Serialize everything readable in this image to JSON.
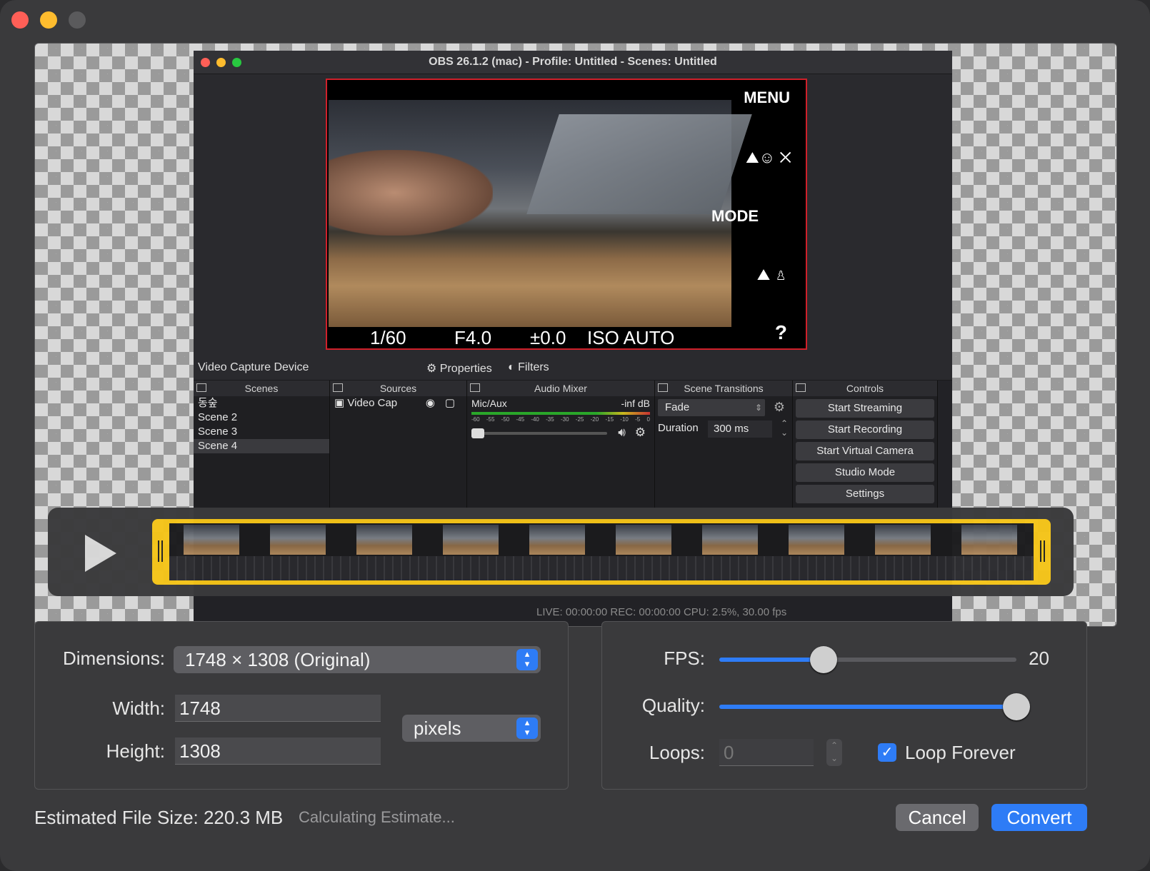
{
  "obs": {
    "title": "OBS 26.1.2 (mac) - Profile: Untitled - Scenes: Untitled",
    "camera": {
      "menu": "MENU",
      "mode": "MODE",
      "help": "?",
      "shutter": "1/60",
      "aperture": "F4.0",
      "exposure": "±0.0",
      "iso": "ISO AUTO"
    },
    "toolbar": {
      "source_name": "Video Capture Device",
      "properties": "Properties",
      "filters": "Filters"
    },
    "docks": {
      "scenes": {
        "title": "Scenes",
        "items": [
          "동숲",
          "Scene 2",
          "Scene 3",
          "Scene 4"
        ]
      },
      "sources": {
        "title": "Sources",
        "item": "Video Cap"
      },
      "mixer": {
        "title": "Audio Mixer",
        "channel": "Mic/Aux",
        "level": "-inf dB",
        "scale": [
          "-60",
          "-55",
          "-50",
          "-45",
          "-40",
          "-35",
          "-30",
          "-25",
          "-20",
          "-15",
          "-10",
          "-5",
          "0"
        ]
      },
      "transitions": {
        "title": "Scene Transitions",
        "type": "Fade",
        "duration_label": "Duration",
        "duration_value": "300 ms"
      },
      "controls": {
        "title": "Controls",
        "buttons": [
          "Start Streaming",
          "Start Recording",
          "Start Virtual Camera",
          "Studio Mode",
          "Settings"
        ]
      }
    },
    "status": "LIVE: 00:00:00     REC: 00:00:00     CPU: 2.5%, 30.00 fps"
  },
  "settings": {
    "dimensions_label": "Dimensions:",
    "dimensions_value": "1748 × 1308 (Original)",
    "width_label": "Width:",
    "width_value": "1748",
    "height_label": "Height:",
    "height_value": "1308",
    "unit": "pixels",
    "fps_label": "FPS:",
    "fps_value": "20",
    "fps_fraction": 0.35,
    "quality_label": "Quality:",
    "quality_fraction": 1.0,
    "loops_label": "Loops:",
    "loops_value": "0",
    "loop_forever_label": "Loop Forever",
    "loop_forever_checked": true
  },
  "footer": {
    "size_label": "Estimated File Size: 220.3 MB",
    "status": "Calculating Estimate...",
    "cancel": "Cancel",
    "convert": "Convert"
  },
  "colors": {
    "accent": "#2e7cf6",
    "trim_handle": "#f5c518",
    "selection": "#d0202a"
  }
}
